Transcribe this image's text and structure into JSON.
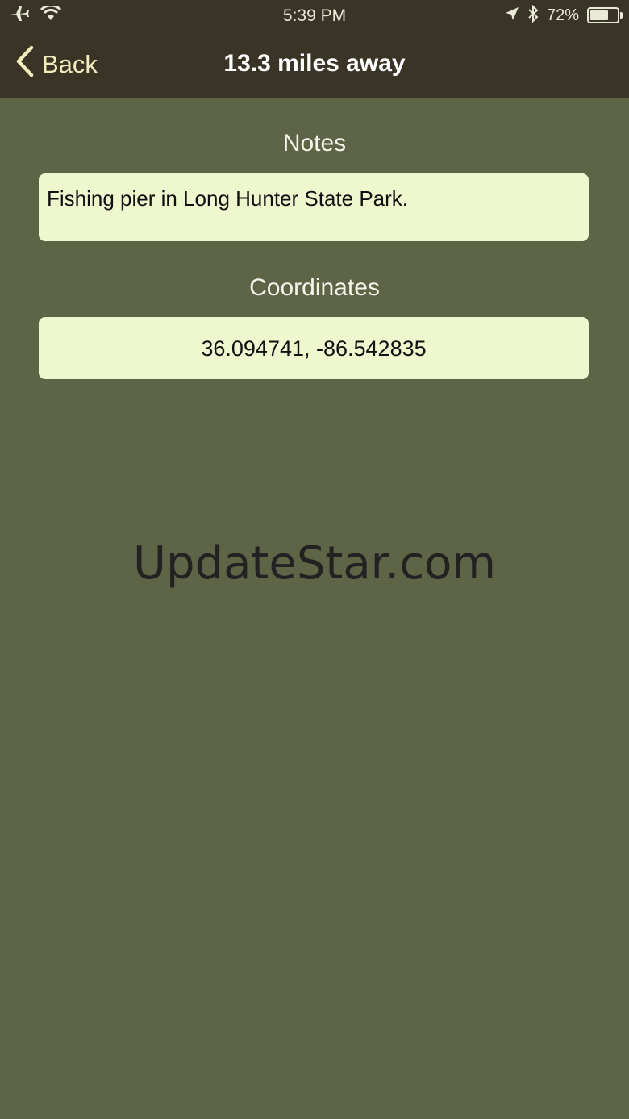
{
  "status_bar": {
    "time": "5:39 PM",
    "battery_percent": "72%",
    "battery_level": 0.72,
    "left_icons": [
      "airplane-icon",
      "wifi-icon"
    ],
    "right_icons": [
      "location-arrow-icon",
      "bluetooth-icon",
      "battery-icon"
    ]
  },
  "nav": {
    "back_label": "Back",
    "title": "13.3 miles away"
  },
  "notes": {
    "label": "Notes",
    "value": "Fishing pier in Long Hunter State Park."
  },
  "coordinates": {
    "label": "Coordinates",
    "value": "36.094741, -86.542835"
  },
  "watermark": "UpdateStar.com",
  "colors": {
    "background": "#5e6446",
    "top_bar": "#3a3426",
    "field_background": "#eff7cf",
    "accent": "#f3edbc"
  }
}
